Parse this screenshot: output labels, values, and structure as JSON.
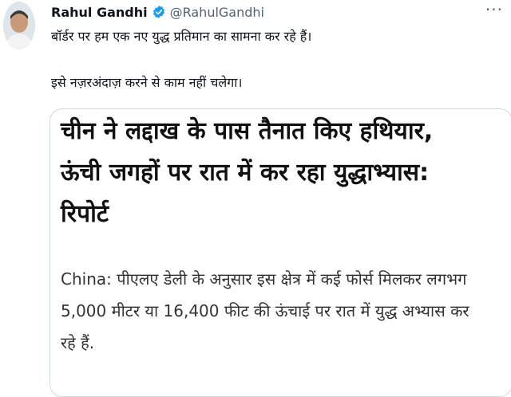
{
  "tweet": {
    "author_name": "Rahul Gandhi",
    "handle": "@RahulGandhi",
    "more_label": "···",
    "text_line1": "बॉर्डर पर हम एक नए युद्ध प्रतिमान का सामना कर रहे हैं।",
    "text_line2": "इसे नज़रअंदाज़ करने से काम नहीं चलेगा।"
  },
  "card": {
    "headline_lines": [
      "चीन ने लद्दाख के पास तैनात किए हथियार,",
      "ऊंची जगहों पर रात में कर रहा युद्धाभ्यास:",
      "रिपोर्ट"
    ],
    "description_lines": [
      "China: पीएलए डेली के अनुसार इस क्षेत्र में कई फोर्स मिलकर लगभग",
      "5,000 मीटर या 16,400 फीट की ऊंचाई पर रात में युद्ध अभ्यास कर",
      "रहे हैं."
    ]
  },
  "colors": {
    "verified_badge": "#1d9bf0",
    "secondary_text": "#536471",
    "card_border": "#cfd9de"
  },
  "icons": {
    "badge": "verified-badge-icon",
    "more": "more-options-icon"
  }
}
